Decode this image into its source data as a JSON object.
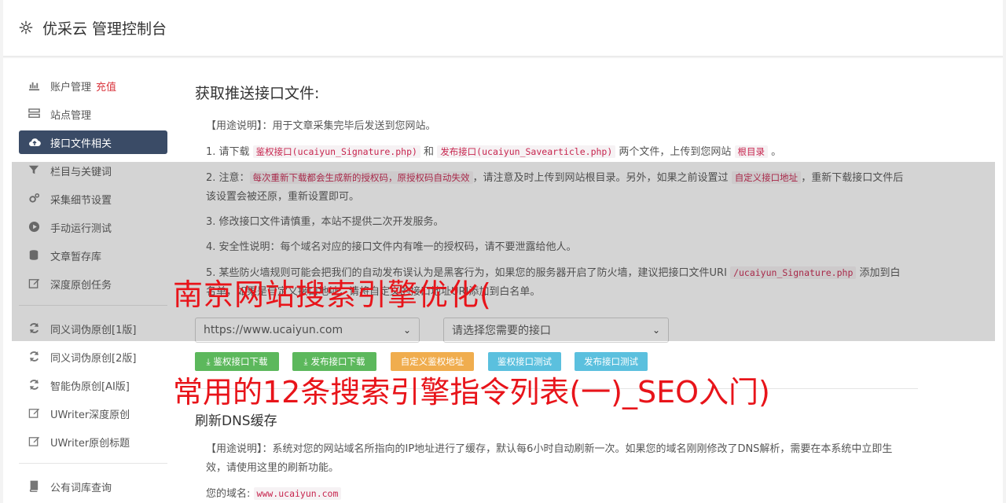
{
  "header": {
    "title": "优采云 管理控制台",
    "icon": "gear-icon"
  },
  "sidebar": {
    "items": [
      {
        "label": "账户管理",
        "extra": "充值",
        "icon": "bar-chart-icon"
      },
      {
        "label": "站点管理",
        "icon": "server-icon"
      },
      {
        "label": "接口文件相关",
        "icon": "cloud-upload-icon",
        "active": true
      },
      {
        "label": "栏目与关键词",
        "icon": "filter-icon"
      },
      {
        "label": "采集细节设置",
        "icon": "cogs-icon"
      },
      {
        "label": "手动运行测试",
        "icon": "play-circle-icon"
      },
      {
        "label": "文章暂存库",
        "icon": "database-icon"
      },
      {
        "label": "深度原创任务",
        "icon": "edit-icon"
      },
      {
        "label": "同义词伪原创[1版]",
        "icon": "refresh-icon"
      },
      {
        "label": "同义词伪原创[2版]",
        "icon": "refresh-icon"
      },
      {
        "label": "智能伪原创[AI版]",
        "icon": "refresh-icon"
      },
      {
        "label": "UWriter深度原创",
        "icon": "edit-icon"
      },
      {
        "label": "UWriter原创标题",
        "icon": "edit-icon"
      },
      {
        "label": "公有词库查询",
        "icon": "book-icon"
      }
    ]
  },
  "main": {
    "title": "获取推送接口文件:",
    "usage": "【用途说明】：用于文章采集完毕后发送到您网站。",
    "step1": {
      "a": "1. 请下载 ",
      "code1": "鉴权接口(ucaiyun_Signature.php)",
      "b": " 和 ",
      "code2": "发布接口(ucaiyun_Savearticle.php)",
      "c": " 两个文件，上传到您网站 ",
      "code3": "根目录",
      "d": " 。"
    },
    "step2": {
      "a": "2. 注意：",
      "code1": "每次重新下载都会生成新的授权码，原授权码自动失效",
      "b": "，请注意及时上传到网站根目录。另外，如果之前设置过 ",
      "code2": "自定义接口地址",
      "c": "，重新下载接口文件后该设置会被还原，重新设置即可。"
    },
    "step3": "3. 修改接口文件请慎重，本站不提供二次开发服务。",
    "step4": "4. 安全性说明：每个域名对应的接口文件内有唯一的授权码，请不要泄露给他人。",
    "step5": {
      "a": "5. 某些防火墙规则可能会把我们的自动发布误认为是黑客行为，如果您的服务器开启了防火墙，建议把接口文件URI ",
      "code1": "/ucaiyun_Signature.php",
      "b": " 添加到白名单，如果是自定义接口地址，请将自定义的接口地址URI添加到白名单。"
    },
    "site_select": "https://www.ucaiyun.com",
    "api_select": "请选择您需要的接口",
    "buttons": {
      "auth_download": "鉴权接口下载",
      "publish_download": "发布接口下载",
      "custom_auth": "自定义鉴权地址",
      "auth_test": "鉴权接口测试",
      "publish_test": "发布接口测试"
    },
    "dns": {
      "title": "刷新DNS缓存",
      "usage": "【用途说明】：系统对您的网站域名所指向的IP地址进行了缓存，默认每6小时自动刷新一次。如果您的域名刚刚修改了DNS解析，需要在本系统中立即生效，请使用这里的刷新功能。",
      "domain_label": "您的域名:",
      "domain_value": "www.ucaiyun.com"
    }
  },
  "watermarks": {
    "line1": "南京网站搜索引擎优化(",
    "line2": "常用的12条搜索引擎指令列表(一)_SEO入门)"
  },
  "colors": {
    "accent_active": "#3a4b66",
    "recharge": "#d9363e",
    "watermark": "#e8141a",
    "code": "#c7254e"
  }
}
